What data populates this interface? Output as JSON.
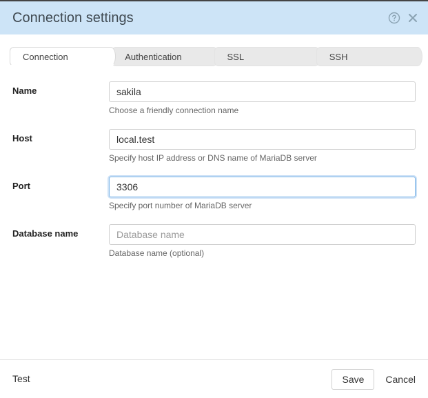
{
  "header": {
    "title": "Connection settings"
  },
  "tabs": {
    "connection": "Connection",
    "authentication": "Authentication",
    "ssl": "SSL",
    "ssh": "SSH"
  },
  "fields": {
    "name": {
      "label": "Name",
      "value": "sakila",
      "help": "Choose a friendly connection name"
    },
    "host": {
      "label": "Host",
      "value": "local.test",
      "help": "Specify host IP address or DNS name of MariaDB server"
    },
    "port": {
      "label": "Port",
      "value": "3306",
      "help": "Specify port number of MariaDB server"
    },
    "database": {
      "label": "Database name",
      "value": "",
      "placeholder": "Database name",
      "help": "Database name (optional)"
    }
  },
  "footer": {
    "test": "Test",
    "save": "Save",
    "cancel": "Cancel"
  }
}
